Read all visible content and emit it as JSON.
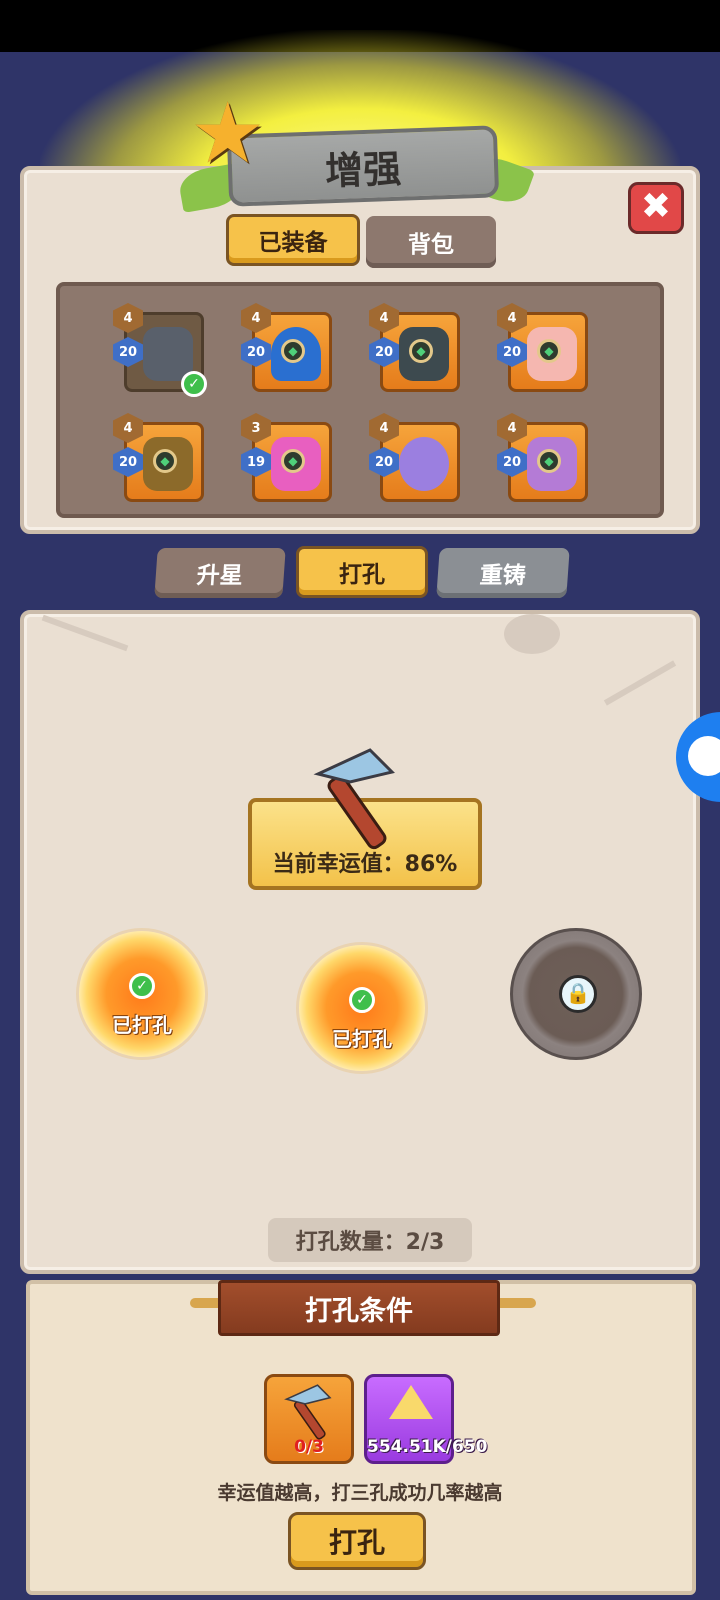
{
  "header": {
    "title": "增强"
  },
  "tabs_top": [
    {
      "label": "已装备",
      "active": true
    },
    {
      "label": "背包",
      "active": false
    }
  ],
  "equipment": [
    {
      "stars": "4",
      "level": "20",
      "equipped": true,
      "icon": "bomb-launcher-icon"
    },
    {
      "stars": "4",
      "level": "20",
      "equipped": false,
      "icon": "helmet-icon"
    },
    {
      "stars": "4",
      "level": "20",
      "equipped": false,
      "icon": "armor-icon"
    },
    {
      "stars": "4",
      "level": "20",
      "equipped": false,
      "icon": "scroll-icon"
    },
    {
      "stars": "4",
      "level": "20",
      "equipped": false,
      "icon": "gloves-icon"
    },
    {
      "stars": "3",
      "level": "19",
      "equipped": false,
      "icon": "boots-icon"
    },
    {
      "stars": "4",
      "level": "20",
      "equipped": false,
      "icon": "ring-icon"
    },
    {
      "stars": "4",
      "level": "20",
      "equipped": false,
      "icon": "necklace-icon"
    }
  ],
  "tabs_mode": [
    {
      "label": "升星"
    },
    {
      "label": "打孔"
    },
    {
      "label": "重铸"
    }
  ],
  "luck": {
    "label": "当前幸运值：86%",
    "value_percent": 86
  },
  "holes": [
    {
      "status": "已打孔",
      "state": "done"
    },
    {
      "status": "已打孔",
      "state": "done"
    },
    {
      "status": "",
      "state": "locked"
    }
  ],
  "hole_count": "打孔数量：2/3",
  "requirements": {
    "title": "打孔条件",
    "pickaxe_amount": "0/3",
    "crystal_amount": "554.51K/650"
  },
  "hint": "幸运值越高，打三孔成功几率越高",
  "action_label": "打孔",
  "colors": {
    "accent": "#f6c24a",
    "background": "#2f3468",
    "panel": "#eadfd2"
  }
}
